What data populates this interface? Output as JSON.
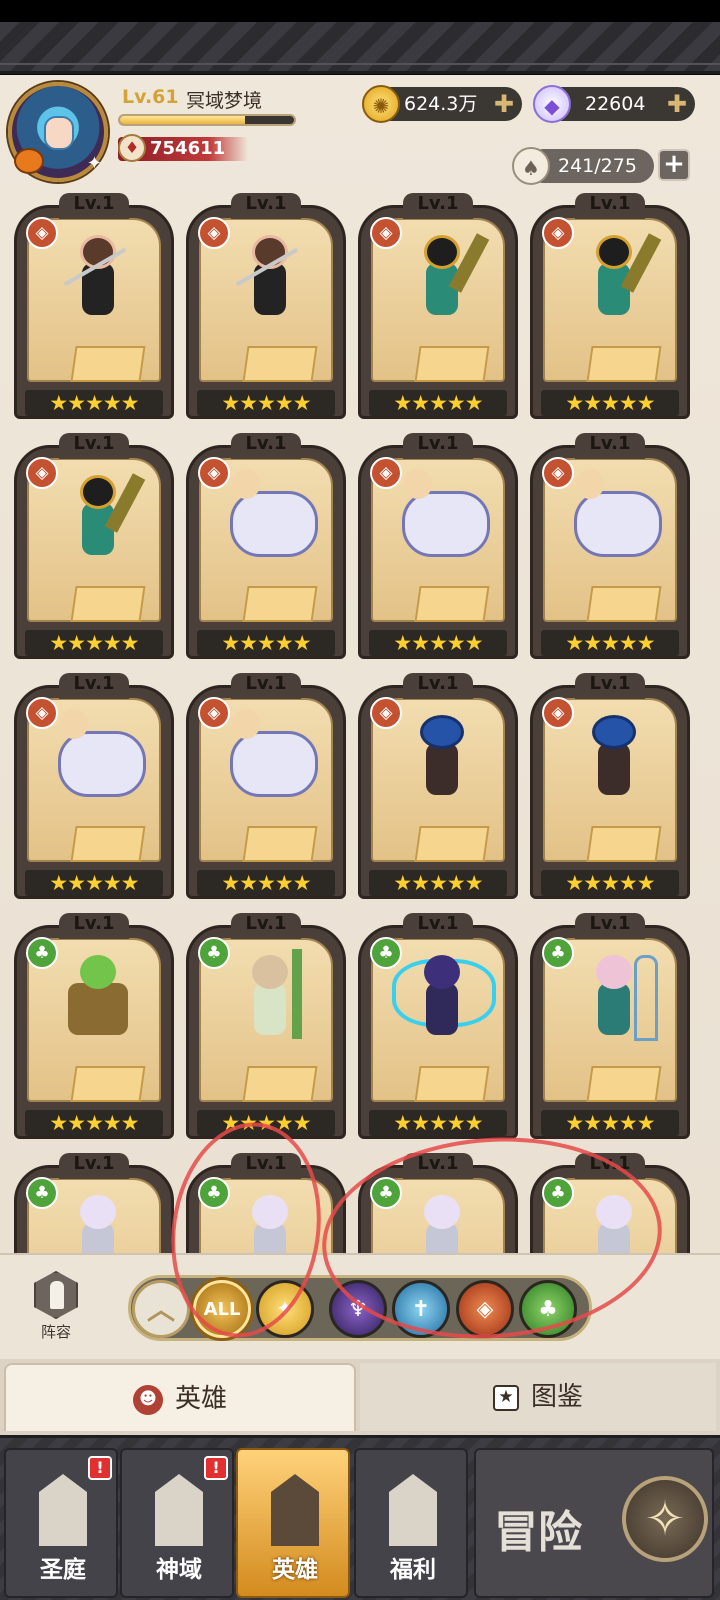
{
  "header": {
    "level": "Lv.61",
    "player_name": "冥域梦境",
    "xp_progress": 0.72,
    "power": "754611",
    "gold": "624.3万",
    "gems": "22604",
    "hero_slots": "241/275"
  },
  "heroes": [
    {
      "level": "Lv.1",
      "faction": "beast",
      "art": "fox",
      "stars": "★★★★★"
    },
    {
      "level": "Lv.1",
      "faction": "beast",
      "art": "fox",
      "stars": "★★★★★"
    },
    {
      "level": "Lv.1",
      "faction": "beast",
      "art": "anubis",
      "stars": "★★★★★"
    },
    {
      "level": "Lv.1",
      "faction": "beast",
      "art": "anubis",
      "stars": "★★★★★"
    },
    {
      "level": "Lv.1",
      "faction": "beast",
      "art": "anubis",
      "stars": "★★★★★"
    },
    {
      "level": "Lv.1",
      "faction": "beast",
      "art": "yeti",
      "stars": "★★★★★"
    },
    {
      "level": "Lv.1",
      "faction": "beast",
      "art": "yeti",
      "stars": "★★★★★"
    },
    {
      "level": "Lv.1",
      "faction": "beast",
      "art": "yeti",
      "stars": "★★★★★"
    },
    {
      "level": "Lv.1",
      "faction": "beast",
      "art": "yeti",
      "stars": "★★★★★"
    },
    {
      "level": "Lv.1",
      "faction": "beast",
      "art": "yeti",
      "stars": "★★★★★"
    },
    {
      "level": "Lv.1",
      "faction": "beast",
      "art": "wolf",
      "stars": "★★★★★"
    },
    {
      "level": "Lv.1",
      "faction": "beast",
      "art": "wolf",
      "stars": "★★★★★"
    },
    {
      "level": "Lv.1",
      "faction": "forest",
      "art": "dryad",
      "stars": "★★★★★"
    },
    {
      "level": "Lv.1",
      "faction": "forest",
      "art": "elf",
      "stars": "★★★★★"
    },
    {
      "level": "Lv.1",
      "faction": "forest",
      "art": "fairy",
      "stars": "★★★★★"
    },
    {
      "level": "Lv.1",
      "faction": "forest",
      "art": "harp",
      "stars": "★★★★★"
    },
    {
      "level": "Lv.1",
      "faction": "forest",
      "art": "small",
      "stars": "★★★★★"
    },
    {
      "level": "Lv.1",
      "faction": "forest",
      "art": "small",
      "stars": "★★★★★"
    },
    {
      "level": "Lv.1",
      "faction": "forest",
      "art": "small",
      "stars": "★★★★★"
    },
    {
      "level": "Lv.1",
      "faction": "forest",
      "art": "small",
      "stars": "★★★★★"
    }
  ],
  "filter": {
    "lineup_label": "阵容",
    "all_label": "ALL",
    "factions": [
      "light-icon",
      "dark-icon",
      "order-icon",
      "beast-icon",
      "forest-icon"
    ]
  },
  "tabs": {
    "heroes": "英雄",
    "codex": "图鉴"
  },
  "nav": {
    "items": [
      {
        "label": "圣庭",
        "badge": "!"
      },
      {
        "label": "神域",
        "badge": "!"
      },
      {
        "label": "英雄",
        "badge": ""
      },
      {
        "label": "福利",
        "badge": ""
      }
    ],
    "adventure": "冒险"
  },
  "colors": {
    "beast": "#c4512f",
    "forest": "#4ea33a",
    "accent_gold": "#d4a23a",
    "annotation_red": "#e64a4a"
  }
}
